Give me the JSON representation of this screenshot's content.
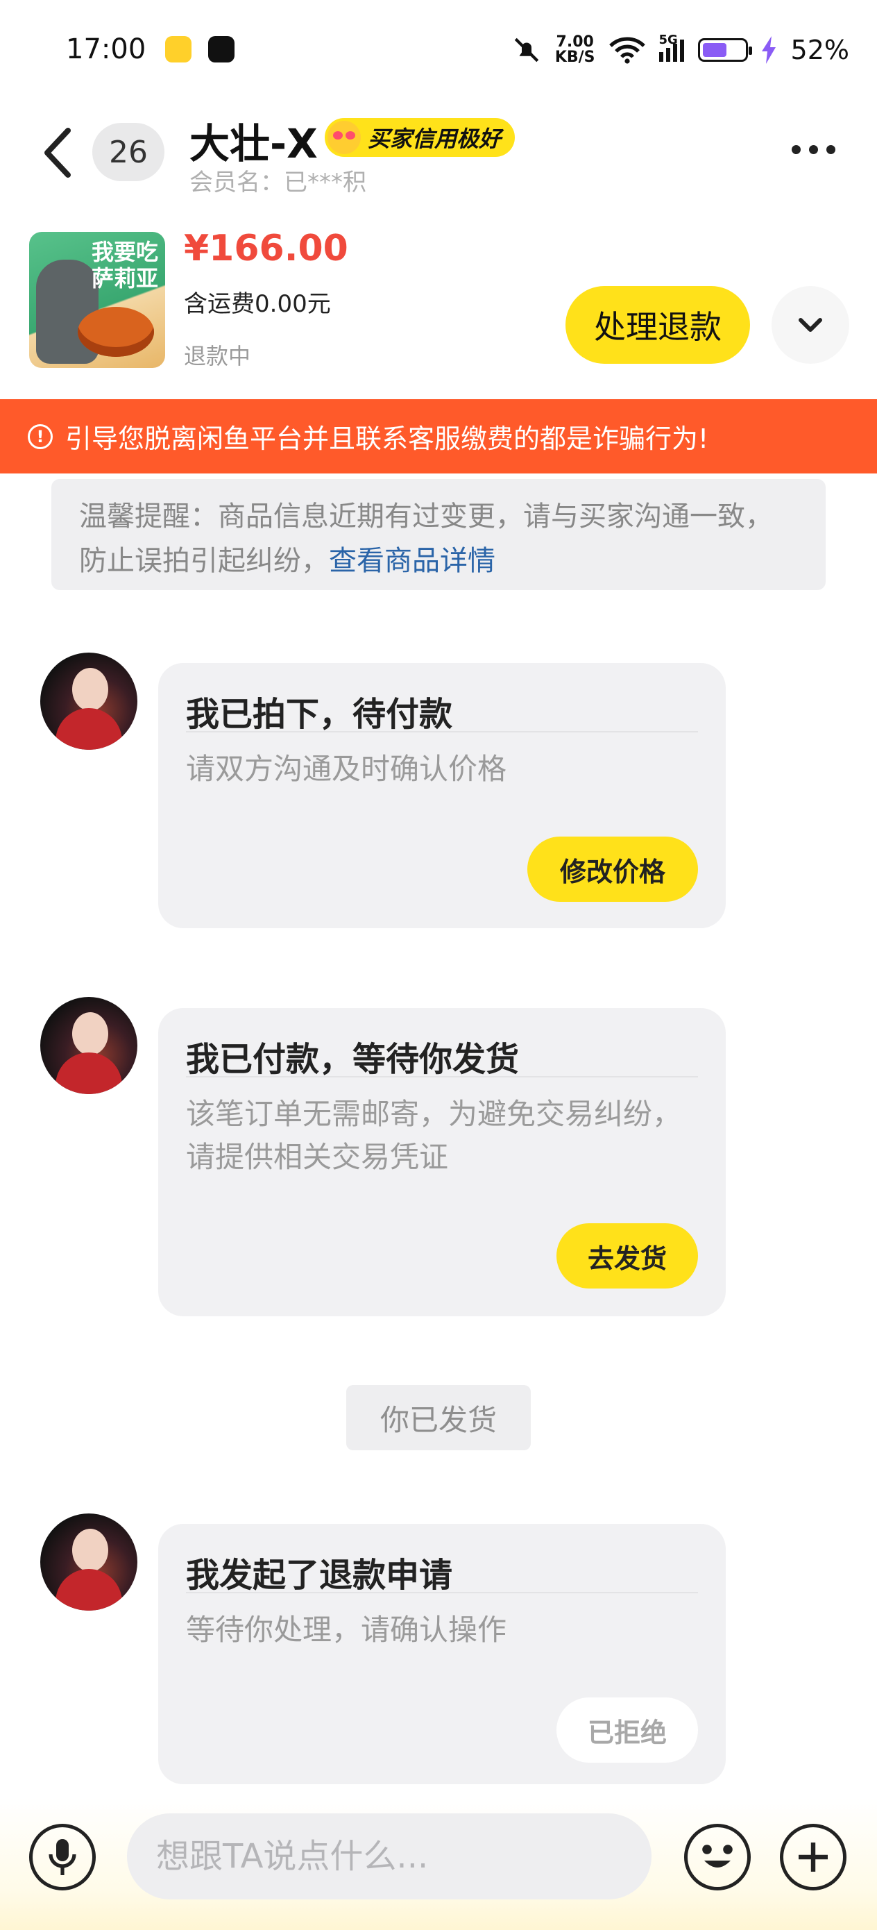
{
  "status_bar": {
    "time": "17:00",
    "net_speed_value": "7.00",
    "net_speed_unit": "KB/S",
    "signal_label": "5G",
    "battery_percent": "52%",
    "battery_level": 0.52,
    "icons": [
      "pet-app-icon",
      "douyin-app-icon",
      "mute-bell-icon",
      "wifi-icon",
      "signal-icon",
      "battery-icon",
      "charging-icon"
    ]
  },
  "header": {
    "unread_count": "26",
    "user_name": "大壮-X",
    "credit_badge": "买家信用极好",
    "member_name": "会员名：已***积"
  },
  "product": {
    "thumb_line1": "我要吃",
    "thumb_line2": "萨莉亚",
    "price": "¥166.00",
    "shipping": "含运费0.00元",
    "status": "退款中",
    "action_label": "处理退款"
  },
  "warning": {
    "text": "引导您脱离闲鱼平台并且联系客服缴费的都是诈骗行为!"
  },
  "tip": {
    "text": "温馨提醒：商品信息近期有过变更，请与买家沟通一致，防止误拍引起纠纷，",
    "link": "查看商品详情"
  },
  "messages": [
    {
      "title": "我已拍下，待付款",
      "desc": "请双方沟通及时确认价格",
      "button": "修改价格",
      "button_enabled": true
    },
    {
      "title": "我已付款，等待你发货",
      "desc": "该笔订单无需邮寄，为避免交易纠纷，请提供相关交易凭证",
      "button": "去发货",
      "button_enabled": true
    },
    {
      "title": "我发起了退款申请",
      "desc": "等待你处理，请确认操作",
      "button": "已拒绝",
      "button_enabled": false
    }
  ],
  "system_note": "你已发货",
  "input": {
    "placeholder": "想跟TA说点什么..."
  },
  "colors": {
    "accent_yellow": "#ffe11a",
    "price_red": "#f04a3c",
    "warning_orange": "#ff5a2a",
    "link_blue": "#2a64a8"
  }
}
